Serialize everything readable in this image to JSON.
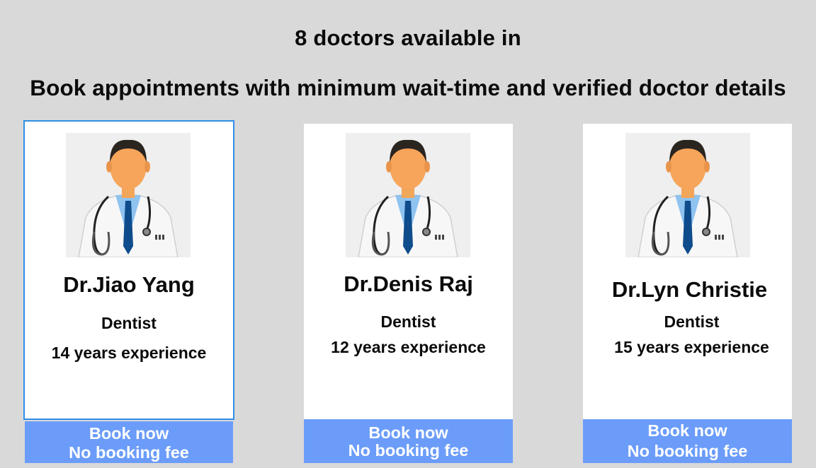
{
  "header": {
    "availability": "8 doctors available in",
    "tagline": "Book appointments with minimum wait-time and verified doctor details"
  },
  "doctors": [
    {
      "name": "Dr.Jiao Yang",
      "specialty": "Dentist",
      "experience": "14 years experience",
      "book_label": "Book now",
      "fee_note": "No booking fee",
      "selected": true
    },
    {
      "name": "Dr.Denis Raj",
      "specialty": "Dentist",
      "experience": "12 years experience",
      "book_label": "Book now",
      "fee_note": "No booking fee",
      "selected": false
    },
    {
      "name": "Dr.Lyn Christie",
      "specialty": "Dentist",
      "experience": "15 years experience",
      "book_label": "Book now",
      "fee_note": "No booking fee",
      "selected": false
    }
  ],
  "colors": {
    "page_bg": "#d9d9d9",
    "card_bg": "#ffffff",
    "selected_border": "#2f8ee6",
    "button_bg": "#6b9cf9",
    "button_text": "#ffffff"
  },
  "icons": {
    "doctor_photo": "doctor-avatar-icon"
  }
}
